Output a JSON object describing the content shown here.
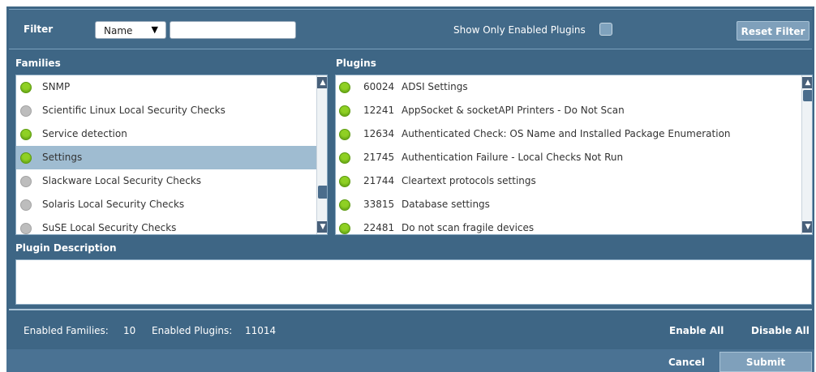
{
  "filter": {
    "label": "Filter",
    "select_value": "Name",
    "select_arrow": "▼",
    "text_value": "",
    "show_only_label": "Show Only Enabled Plugins",
    "reset_label": "Reset Filter"
  },
  "families": {
    "title": "Families",
    "items": [
      {
        "label": "SNMP",
        "enabled": true
      },
      {
        "label": "Scientific Linux Local Security Checks",
        "enabled": false
      },
      {
        "label": "Service detection",
        "enabled": true
      },
      {
        "label": "Settings",
        "enabled": true,
        "selected": true
      },
      {
        "label": "Slackware Local Security Checks",
        "enabled": false
      },
      {
        "label": "Solaris Local Security Checks",
        "enabled": false
      },
      {
        "label": "SuSE Local Security Checks",
        "enabled": false
      }
    ]
  },
  "plugins": {
    "title": "Plugins",
    "items": [
      {
        "id": "60024",
        "name": "ADSI Settings"
      },
      {
        "id": "12241",
        "name": "AppSocket & socketAPI Printers - Do Not Scan"
      },
      {
        "id": "12634",
        "name": "Authenticated Check: OS Name and Installed Package Enumeration"
      },
      {
        "id": "21745",
        "name": "Authentication Failure - Local Checks Not Run"
      },
      {
        "id": "21744",
        "name": "Cleartext protocols settings"
      },
      {
        "id": "33815",
        "name": "Database settings"
      },
      {
        "id": "22481",
        "name": "Do not scan fragile devices"
      }
    ]
  },
  "description": {
    "title": "Plugin Description",
    "text": ""
  },
  "stats": {
    "families_label": "Enabled Families:",
    "families_value": "10",
    "plugins_label": "Enabled Plugins:",
    "plugins_value": "11014"
  },
  "actions": {
    "enable_all": "Enable All",
    "disable_all": "Disable All",
    "cancel": "Cancel",
    "submit": "Submit"
  },
  "icons": {
    "enabled": "green-dot-icon",
    "disabled": "gray-dot-icon",
    "scroll_up": "▲",
    "scroll_down": "▼"
  },
  "colors": {
    "panel": "#3e6685",
    "enabled": "#8fd024",
    "disabled": "#bdbdbd",
    "selected_row": "#9fbcd1"
  }
}
